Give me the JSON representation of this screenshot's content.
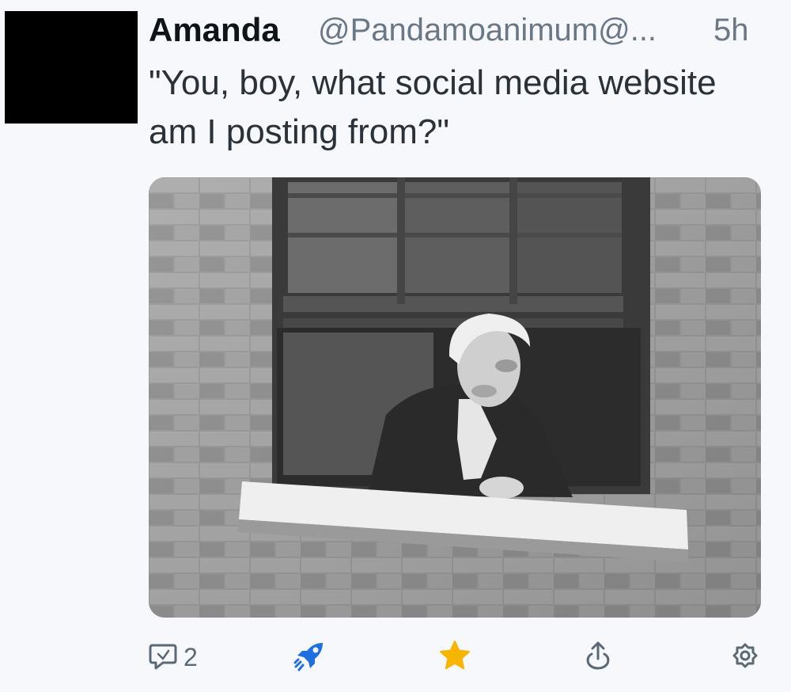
{
  "post": {
    "author_name": "Amanda",
    "handle": "@Pandamoanimum@...",
    "time_ago": "5h",
    "text": "\"You, boy, what social media website am I posting from?\""
  },
  "actions": {
    "reply_count": "2",
    "icons": [
      "reply-icon",
      "boost-rocket-icon",
      "favourite-star-icon",
      "share-icon",
      "more-settings-icon"
    ]
  },
  "colors": {
    "boost": "#1f6fe0",
    "favourite": "#f7b500",
    "muted": "#5b6875",
    "background": "#f6f8fb"
  }
}
